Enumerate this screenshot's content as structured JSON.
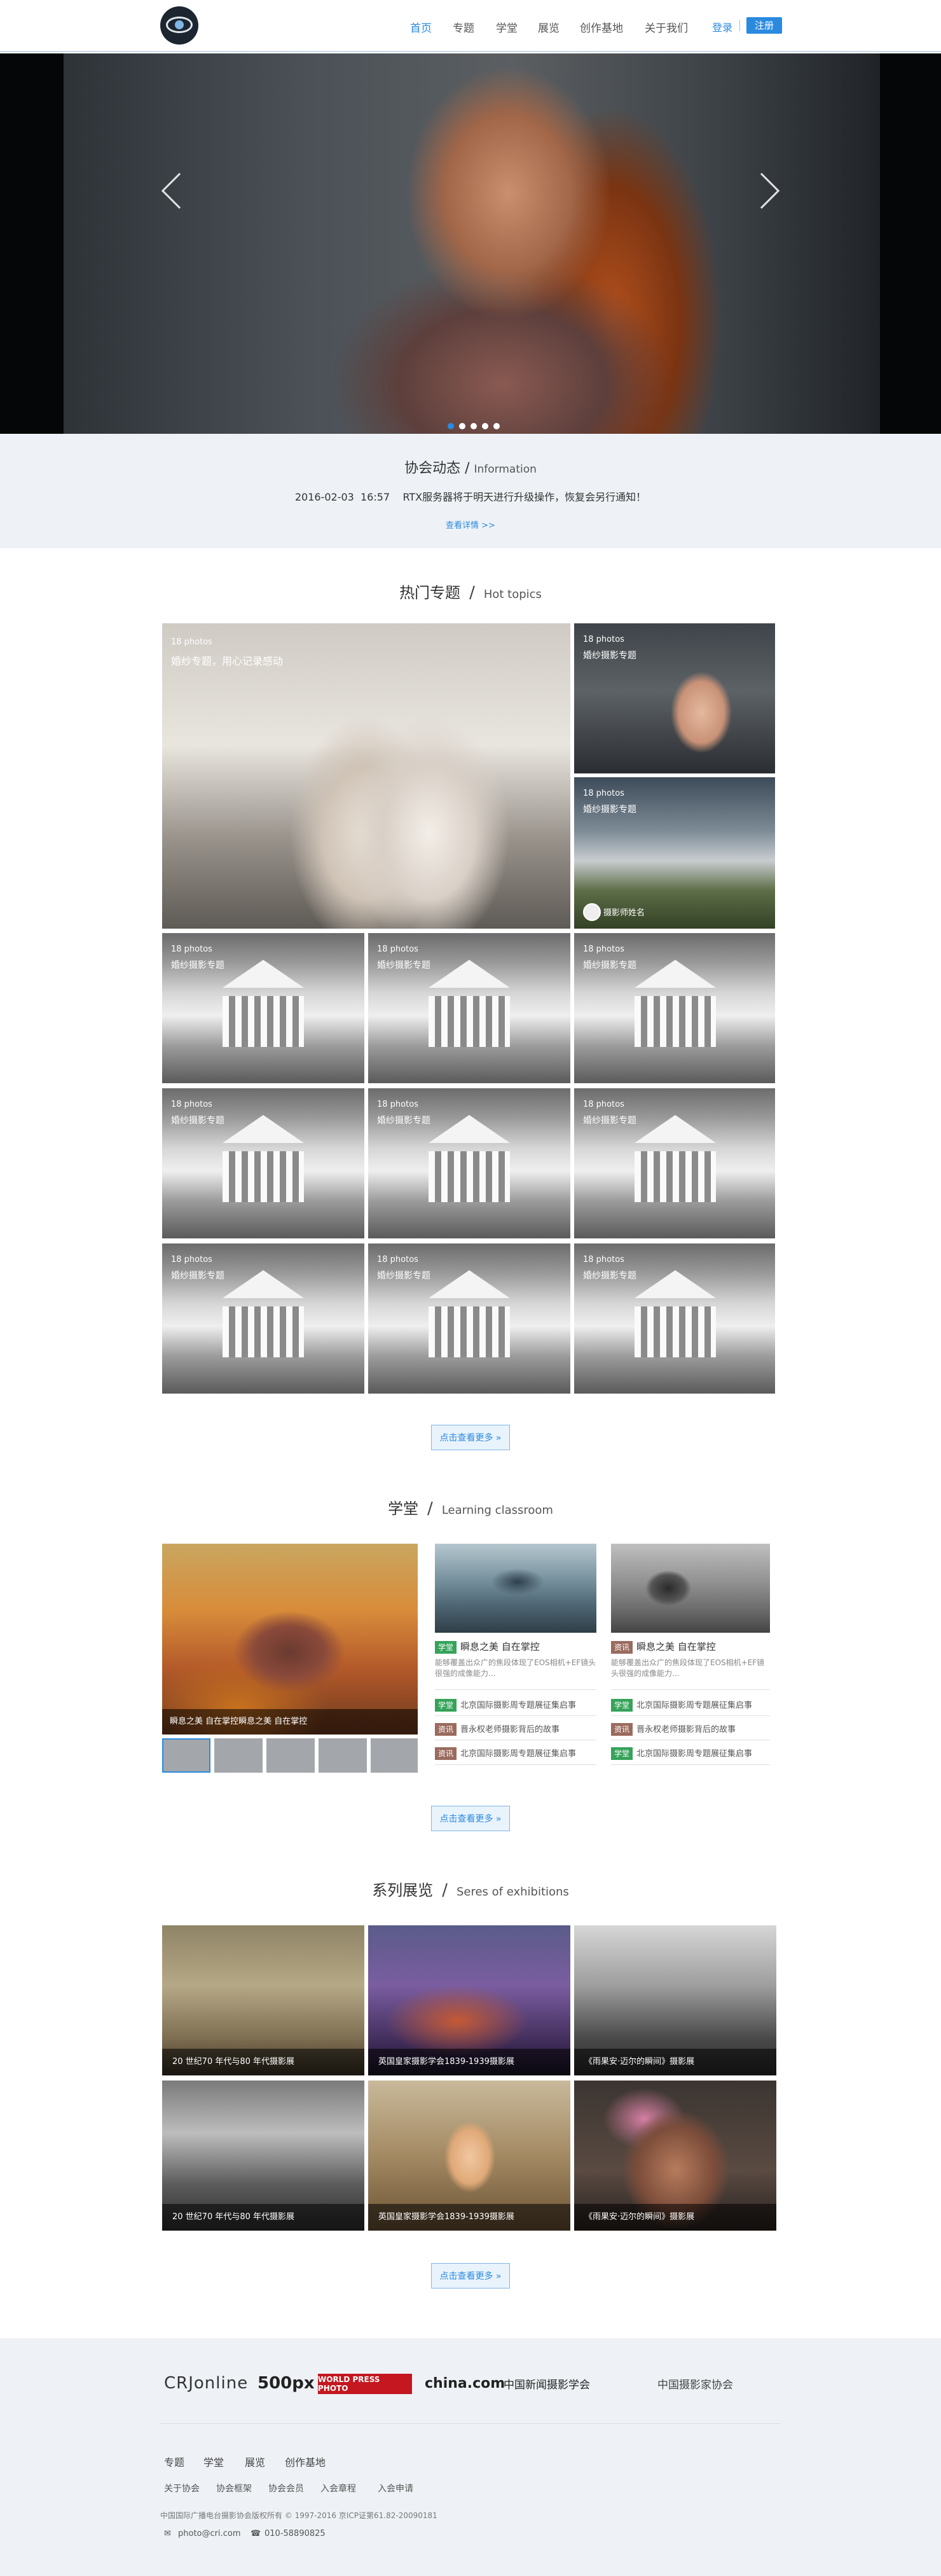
{
  "nav": {
    "items": [
      "首页",
      "专题",
      "学堂",
      "展览",
      "创作基地",
      "关于我们"
    ],
    "login": "登录",
    "register": "注册"
  },
  "news": {
    "title_cn": "协会动态",
    "title_en": "Information",
    "date": "2016-02-03",
    "time": "16:57",
    "text": "RTX服务器将于明天进行升级操作，恢复会另行通知！",
    "more": "查看详情 >>"
  },
  "topics": {
    "title_cn": "热门专题",
    "title_en": "Hot topics",
    "big": {
      "count": "18 photos",
      "title": "婚纱专题，用心记录感动"
    },
    "small1": {
      "count": "18 photos",
      "title": "婚纱摄影专题"
    },
    "small2": {
      "count": "18 photos",
      "title": "婚纱摄影专题",
      "author": "摄影师姓名"
    },
    "grid_count": "18 photos",
    "grid_title": "婚纱摄影专题",
    "more": "点击查看更多 »"
  },
  "classroom": {
    "title_cn": "学堂",
    "title_en": "Learning classroom",
    "feature_caption": "瞬息之美 自在掌控瞬息之美 自在掌控",
    "cards": [
      {
        "tag": "学堂",
        "tag_color": "#36a35a",
        "title": "瞬息之美 自在掌控",
        "desc": "能够覆盖出众广的焦段体现了EOS相机+EF镜头很强的成像能力..."
      },
      {
        "tag": "资讯",
        "tag_color": "#9a6b5e",
        "title": "瞬息之美 自在掌控",
        "desc": "能够覆盖出众广的焦段体现了EOS相机+EF镜头很强的成像能力..."
      }
    ],
    "col1_list": [
      {
        "tag": "学堂",
        "text": "北京国际摄影周专题展征集启事"
      },
      {
        "tag": "资讯",
        "text": "晋永权老师摄影背后的故事"
      },
      {
        "tag": "资讯",
        "text": "北京国际摄影周专题展征集启事"
      }
    ],
    "col2_list": [
      {
        "tag": "学堂",
        "text": "北京国际摄影周专题展征集启事"
      },
      {
        "tag": "资讯",
        "text": "晋永权老师摄影背后的故事"
      },
      {
        "tag": "学堂",
        "text": "北京国际摄影周专题展征集启事"
      }
    ],
    "more": "点击查看更多 »"
  },
  "expo": {
    "title_cn": "系列展览",
    "title_en": "Seres of exhibitions",
    "items": [
      "20 世纪70 年代与80 年代摄影展",
      "英国皇家摄影学会1839-1939摄影展",
      "《雨果安·迈尔的瞬间》摄影展",
      "20 世纪70 年代与80 年代摄影展",
      "英国皇家摄影学会1839-1939摄影展",
      "《雨果安·迈尔的瞬间》摄影展"
    ],
    "more": "点击查看更多 »"
  },
  "footer": {
    "partners": [
      "CRJonline",
      "500px",
      "WORLD PRESS PHOTO",
      "china.com",
      "中国新闻摄影学会",
      "中国摄影家协会"
    ],
    "nav": [
      "专题",
      "学堂",
      "展览",
      "创作基地"
    ],
    "sub": [
      "关于协会",
      "协会框架",
      "协会会员",
      "入会章程",
      "入会申请"
    ],
    "copyright": "中国国际广播电台摄影协会版权所有 © 1997-2016 京ICP证第61.82-20090181",
    "email": "photo@cri.com",
    "phone": "010-58890825"
  },
  "colors": {
    "accent": "#2a8ae0",
    "tag_green": "#36a35a",
    "tag_brown": "#9a6b5e"
  }
}
